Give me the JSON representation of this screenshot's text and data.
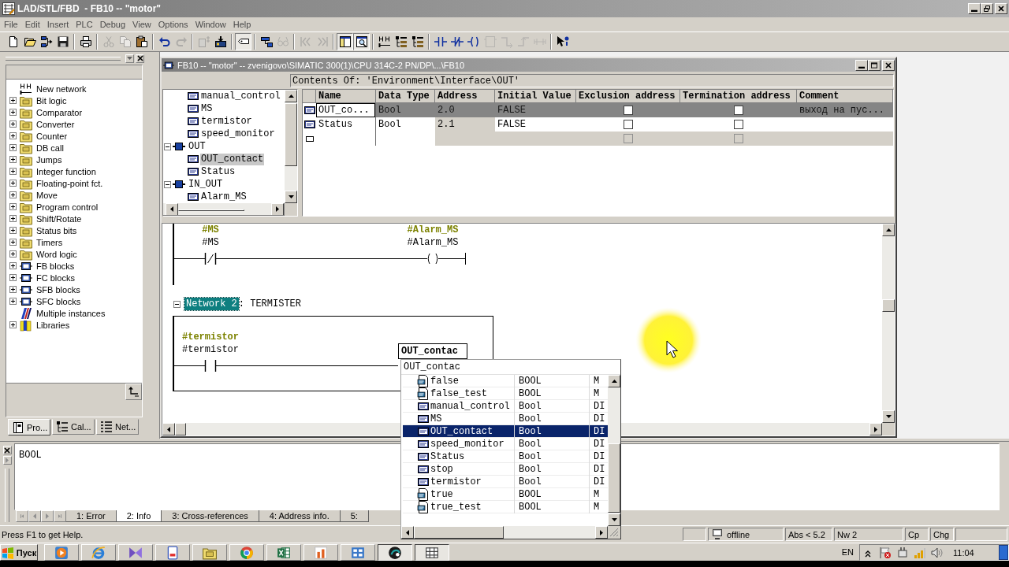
{
  "window": {
    "title": "LAD/STL/FBD  - FB10 -- \"motor\""
  },
  "menu": [
    "File",
    "Edit",
    "Insert",
    "PLC",
    "Debug",
    "View",
    "Options",
    "Window",
    "Help"
  ],
  "toolbar": [
    [
      {
        "kind": "page",
        "disabled": false,
        "pressed": false
      },
      {
        "kind": "open",
        "disabled": false,
        "pressed": false
      },
      {
        "kind": "nodes",
        "disabled": false,
        "pressed": false
      },
      {
        "kind": "save",
        "disabled": false,
        "pressed": false
      }
    ],
    [
      {
        "kind": "print",
        "disabled": false,
        "pressed": false
      }
    ],
    [
      {
        "kind": "cut",
        "disabled": true,
        "pressed": false
      },
      {
        "kind": "copy",
        "disabled": true,
        "pressed": false
      },
      {
        "kind": "paste",
        "disabled": false,
        "pressed": false
      }
    ],
    [
      {
        "kind": "undo",
        "disabled": false,
        "pressed": false
      },
      {
        "kind": "redo",
        "disabled": true,
        "pressed": false
      }
    ],
    [
      {
        "kind": "upload",
        "disabled": true,
        "pressed": false
      },
      {
        "kind": "download",
        "disabled": false,
        "pressed": false
      }
    ],
    [
      {
        "kind": "tag",
        "disabled": false,
        "pressed": true
      }
    ],
    [
      {
        "kind": "node",
        "disabled": false,
        "pressed": false
      },
      {
        "kind": "glasses",
        "disabled": true,
        "pressed": false
      }
    ],
    [
      {
        "kind": "prev",
        "disabled": true,
        "pressed": false
      },
      {
        "kind": "next",
        "disabled": true,
        "pressed": false
      }
    ],
    [
      {
        "kind": "overview",
        "disabled": false,
        "pressed": true
      },
      {
        "kind": "details",
        "disabled": false,
        "pressed": true
      }
    ],
    [
      {
        "kind": "rung",
        "disabled": false,
        "pressed": false
      },
      {
        "kind": "tree",
        "disabled": false,
        "pressed": false
      },
      {
        "kind": "tree",
        "disabled": false,
        "pressed": false
      }
    ],
    [
      {
        "kind": "no_contact",
        "disabled": false,
        "pressed": false
      },
      {
        "kind": "nc_contact",
        "disabled": false,
        "pressed": false
      },
      {
        "kind": "coil",
        "disabled": false,
        "pressed": false
      },
      {
        "kind": "box",
        "disabled": true,
        "pressed": false
      },
      {
        "kind": "branch_open",
        "disabled": true,
        "pressed": false
      },
      {
        "kind": "branch_close",
        "disabled": true,
        "pressed": false
      },
      {
        "kind": "jumper",
        "disabled": true,
        "pressed": false
      }
    ],
    [
      {
        "kind": "help",
        "disabled": false,
        "pressed": false
      }
    ]
  ],
  "program_elements": {
    "items": [
      {
        "label": "New network",
        "kind": "network"
      },
      {
        "label": "Bit logic",
        "kind": "folder",
        "expanded": false
      },
      {
        "label": "Comparator",
        "kind": "folder",
        "expanded": false
      },
      {
        "label": "Converter",
        "kind": "folder",
        "expanded": false
      },
      {
        "label": "Counter",
        "kind": "folder",
        "expanded": false
      },
      {
        "label": "DB call",
        "kind": "folder",
        "expanded": false
      },
      {
        "label": "Jumps",
        "kind": "folder",
        "expanded": false
      },
      {
        "label": "Integer function",
        "kind": "folder",
        "expanded": false
      },
      {
        "label": "Floating-point fct.",
        "kind": "folder",
        "expanded": false
      },
      {
        "label": "Move",
        "kind": "folder",
        "expanded": false
      },
      {
        "label": "Program control",
        "kind": "folder",
        "expanded": false
      },
      {
        "label": "Shift/Rotate",
        "kind": "folder",
        "expanded": false
      },
      {
        "label": "Status bits",
        "kind": "folder",
        "expanded": false
      },
      {
        "label": "Timers",
        "kind": "folder",
        "expanded": false
      },
      {
        "label": "Word logic",
        "kind": "folder",
        "expanded": false
      },
      {
        "label": "FB blocks",
        "kind": "block",
        "expanded": false
      },
      {
        "label": "FC blocks",
        "kind": "block",
        "expanded": false
      },
      {
        "label": "SFB blocks",
        "kind": "block",
        "expanded": false
      },
      {
        "label": "SFC blocks",
        "kind": "block",
        "expanded": false
      },
      {
        "label": "Multiple instances",
        "kind": "instances"
      },
      {
        "label": "Libraries",
        "kind": "library",
        "expanded": false
      }
    ],
    "tabs": [
      {
        "label": "Pro...",
        "kind": "program",
        "selected": true
      },
      {
        "label": "Cal...",
        "kind": "calls",
        "selected": false
      },
      {
        "label": "Net...",
        "kind": "networks",
        "selected": false
      }
    ]
  },
  "block_window": {
    "title": "FB10 -- \"motor\" -- zvenigovo\\SIMATIC 300(1)\\CPU 314C-2 PN/DP\\...\\FB10",
    "contents_of": "Contents Of: 'Environment\\Interface\\OUT'",
    "interface_tree": [
      {
        "children": [
          {
            "label": "manual_control",
            "selected": false
          },
          {
            "label": "MS",
            "selected": false
          },
          {
            "label": "termistor",
            "selected": false
          },
          {
            "label": "speed_monitor",
            "selected": false
          }
        ]
      },
      {
        "label": "OUT",
        "expanded": true,
        "children": [
          {
            "label": "OUT_contact",
            "selected": true
          },
          {
            "label": "Status",
            "selected": false
          }
        ]
      },
      {
        "label": "IN_OUT",
        "expanded": true,
        "children": [
          {
            "label": "Alarm_MS",
            "selected": false
          }
        ]
      }
    ],
    "table": {
      "columns": [
        "Name",
        "Data Type",
        "Address",
        "Initial Value",
        "Exclusion address",
        "Termination address",
        "Comment"
      ],
      "rows": [
        {
          "kind": "declaration",
          "selected": true,
          "name": "OUT_co...",
          "data_type": "Bool",
          "address": "2.0",
          "initial_value": "FALSE",
          "exclusion_address": {
            "checked": false,
            "disabled": false
          },
          "termination_address": {
            "checked": false,
            "disabled": false
          },
          "comment": "выход на пус..."
        },
        {
          "kind": "declaration",
          "selected": false,
          "name": "Status",
          "data_type": "Bool",
          "address": "2.1",
          "initial_value": "FALSE",
          "exclusion_address": {
            "checked": false,
            "disabled": false
          },
          "termination_address": {
            "checked": false,
            "disabled": false
          }
        },
        {
          "kind": "new",
          "selected": false,
          "exclusion_address": {
            "checked": false,
            "disabled": true
          },
          "termination_address": {
            "checked": false,
            "disabled": true
          }
        }
      ]
    },
    "networks": [
      {
        "elements": [
          {
            "kind": "nc_contact",
            "symbol": "#MS",
            "operand": "#MS"
          },
          {
            "kind": "coil",
            "symbol": "#Alarm_MS",
            "operand": "#Alarm_MS"
          }
        ]
      },
      {
        "label": "Network 2",
        "title": ": TERMISTER",
        "selected": true,
        "expanded": true,
        "elements": [
          {
            "kind": "no_contact",
            "symbol": "#termistor",
            "operand": "#termistor"
          },
          {
            "kind": "operand_input",
            "value": "OUT_contac"
          }
        ]
      }
    ]
  },
  "autocomplete": {
    "query": "OUT_contac",
    "items": [
      {
        "kind": "symbol",
        "name": "false",
        "type": "BOOL",
        "area": "M",
        "selected": false
      },
      {
        "kind": "symbol",
        "name": "false_test",
        "type": "BOOL",
        "area": "M",
        "selected": false
      },
      {
        "kind": "variable",
        "name": "manual_control",
        "type": "Bool",
        "area": "DI",
        "selected": false
      },
      {
        "kind": "variable",
        "name": "MS",
        "type": "Bool",
        "area": "DI",
        "selected": false
      },
      {
        "kind": "variable",
        "name": "OUT_contact",
        "type": "Bool",
        "area": "DI",
        "selected": true
      },
      {
        "kind": "variable",
        "name": "speed_monitor",
        "type": "Bool",
        "area": "DI",
        "selected": false
      },
      {
        "kind": "variable",
        "name": "Status",
        "type": "Bool",
        "area": "DI",
        "selected": false
      },
      {
        "kind": "variable",
        "name": "stop",
        "type": "Bool",
        "area": "DI",
        "selected": false
      },
      {
        "kind": "variable",
        "name": "termistor",
        "type": "Bool",
        "area": "DI",
        "selected": false
      },
      {
        "kind": "symbol",
        "name": "true",
        "type": "BOOL",
        "area": "M",
        "selected": false
      },
      {
        "kind": "symbol",
        "name": "true_test",
        "type": "BOOL",
        "area": "M",
        "selected": false
      }
    ]
  },
  "details": {
    "text": "BOOL",
    "tabs": [
      {
        "label": "1: Error",
        "selected": false
      },
      {
        "label": "2: Info",
        "selected": true
      },
      {
        "label": "3: Cross-references",
        "selected": false
      },
      {
        "label": "4: Address info.",
        "selected": false
      },
      {
        "label": "5:",
        "selected": false
      }
    ]
  },
  "status_bar": {
    "help": "Press F1 to get Help.",
    "connection": "offline",
    "fields": [
      "Abs < 5.2",
      "Nw 2",
      "Cp",
      "Chg"
    ]
  },
  "taskbar": {
    "start": "Пуск",
    "apps": [
      {
        "kind": "media",
        "selected": false
      },
      {
        "kind": "ring",
        "selected": false
      },
      {
        "kind": "chevron",
        "selected": false
      },
      {
        "kind": "document",
        "selected": false
      },
      {
        "kind": "folder",
        "selected": false
      },
      {
        "kind": "circle",
        "selected": false
      },
      {
        "kind": "sheet",
        "selected": false
      },
      {
        "kind": "chart",
        "selected": false
      },
      {
        "kind": "panel",
        "selected": false
      },
      {
        "kind": "swirl",
        "selected": true
      },
      {
        "kind": "grid",
        "selected": true
      }
    ],
    "language": "EN",
    "clock": "11:04"
  }
}
